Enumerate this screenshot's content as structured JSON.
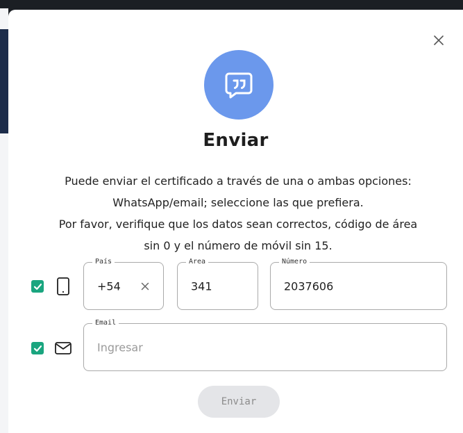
{
  "modal": {
    "title": "Enviar",
    "description_lines": [
      "Puede enviar el certificado a través de una o ambas opciones:",
      "WhatsApp/email; seleccione las que prefiera.",
      "Por favor, verifique que los datos sean correctos, código de área",
      "sin 0 y el número de móvil sin 15."
    ],
    "hero_icon": "quote-chat-icon",
    "close_icon": "close-icon"
  },
  "phone_row": {
    "checked": true,
    "icon": "mobile-phone-icon",
    "pais": {
      "label": "País",
      "value": "+54"
    },
    "area": {
      "label": "Area",
      "value": "341"
    },
    "numero": {
      "label": "Número",
      "value": "2037606"
    }
  },
  "email_row": {
    "checked": true,
    "icon": "envelope-icon",
    "email": {
      "label": "Email",
      "value": "",
      "placeholder": "Ingresar"
    }
  },
  "submit": {
    "label": "Enviar",
    "disabled": true
  },
  "colors": {
    "accent_blue": "#6b98ec",
    "checkbox_green": "#1aa57f",
    "disabled_button": "#e4e5e8"
  }
}
